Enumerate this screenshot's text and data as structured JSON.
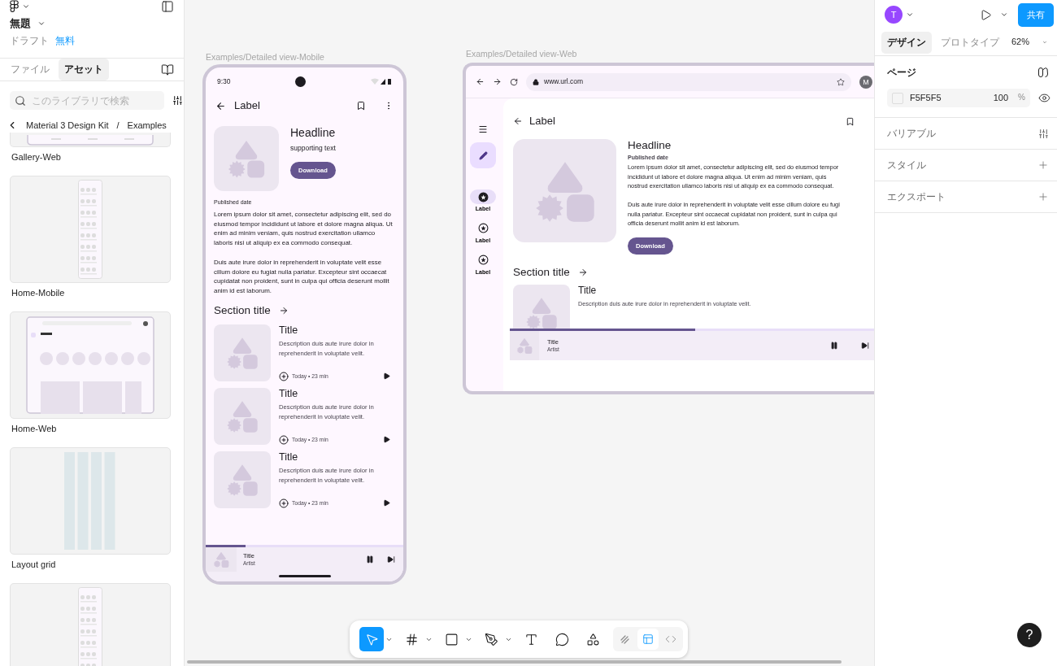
{
  "left_panel": {
    "file_name": "無題",
    "location": "ドラフト",
    "plan": "無料",
    "tabs": [
      {
        "label": "ファイル",
        "selected": false
      },
      {
        "label": "アセット",
        "selected": true
      }
    ],
    "search": {
      "placeholder": "このライブラリで検索"
    },
    "breadcrumb": {
      "library": "Material 3 Design Kit",
      "separator": "/",
      "folder": "Examples"
    },
    "assets": [
      {
        "name": "Gallery-Web",
        "kind": "web_strip"
      },
      {
        "name": "Home-Mobile",
        "kind": "mobile"
      },
      {
        "name": "Home-Web",
        "kind": "web"
      },
      {
        "name": "Layout grid",
        "kind": "grid"
      },
      {
        "kind": "mobile"
      }
    ]
  },
  "canvas": {
    "mobile_frame": {
      "label": "Examples/Detailed view-Mobile",
      "time": "9:30",
      "top_bar_title": "Label",
      "headline": "Headline",
      "supporting_text": "supporting text",
      "button": "Download",
      "date_label": "Published date",
      "paragraphs": [
        "Lorem ipsum dolor sit amet, consectetur adipiscing elit, sed do eiusmod tempor incididunt ut labore et dolore magna aliqua. Ut enim ad minim veniam, quis nostrud exercitation ullamco laboris nisi ut aliquip ex ea commodo consequat.",
        "Duis aute irure dolor in reprehenderit in voluptate velit esse cillum dolore eu fugiat nulla pariatur. Excepteur sint occaecat cupidatat non proident, sunt in culpa qui officia deserunt mollit anim id est laborum."
      ],
      "section_title": "Section title",
      "items": [
        {
          "title": "Title",
          "description": "Description duis aute irure dolor in reprehenderit in voluptate velit.",
          "meta": "Today • 23 min"
        },
        {
          "title": "Title",
          "description": "Description duis aute irure dolor in reprehenderit in voluptate velit.",
          "meta": "Today • 23 min"
        },
        {
          "title": "Title",
          "description": "Description duis aute irure dolor in reprehenderit in voluptate velit.",
          "meta": "Today • 23 min"
        }
      ],
      "player": {
        "title": "Title",
        "artist": "Artist",
        "level": 0.2
      }
    },
    "web_frame": {
      "label": "Examples/Detailed view-Web",
      "url": "www.url.com",
      "avatar": "M",
      "nav": [
        {
          "label": "Label",
          "selected": true
        },
        {
          "label": "Label",
          "selected": false
        },
        {
          "label": "Label",
          "selected": false
        }
      ],
      "top_bar_title": "Label",
      "headline": "Headline",
      "date_label": "Published date",
      "paragraphs": [
        [
          "Lorem ipsum dolor sit amet, consectetur adipiscing elit, sed do eiusmod tempor",
          "incididunt ut labore et dolore magna aliqua. Ut enim ad minim veniam, quis",
          "nostrud exercitation ullamco laboris nisi ut aliquip ex ea commodo consequat."
        ],
        [
          "Duis aute irure dolor in reprehenderit in voluptate velit esse cillum dolore eu fugi",
          "nulla pariatur. Excepteur sint occaecat cupidatat non proident, sunt in culpa qui",
          "officia deserunt mollit anim id est laborum."
        ]
      ],
      "button": "Download",
      "section_title": "Section title",
      "items": [
        {
          "title": "Title",
          "description": "Description duis aute irure dolor in reprehenderit in voluptate velit."
        }
      ],
      "player": {
        "title": "Title",
        "artist": "Artist",
        "level": 0.51
      }
    },
    "toolbar": {
      "tools": [
        {
          "kind": "move",
          "selected": true,
          "menu": true
        },
        {
          "kind": "frame",
          "selected": false,
          "menu": true
        },
        {
          "kind": "rect",
          "selected": false,
          "menu": true
        },
        {
          "kind": "pen",
          "selected": false,
          "menu": true
        },
        {
          "kind": "text",
          "selected": false,
          "menu": false
        },
        {
          "kind": "comment",
          "selected": false,
          "menu": false
        },
        {
          "kind": "components",
          "selected": false,
          "menu": false
        }
      ],
      "modes": [
        {
          "kind": "draw",
          "selected": false
        },
        {
          "kind": "design",
          "selected": true
        },
        {
          "kind": "dev",
          "selected": false
        }
      ]
    },
    "help": "?"
  },
  "right_panel": {
    "avatar": "T",
    "share": "共有",
    "tabs": [
      {
        "label": "デザイン",
        "selected": true
      },
      {
        "label": "プロトタイプ",
        "selected": false
      }
    ],
    "zoom": "62%",
    "page_section": "ページ",
    "page_color": {
      "hex": "F5F5F5",
      "opacity": "100",
      "unit": "%"
    },
    "sections": [
      {
        "label": "バリアブル",
        "kind": "library"
      },
      {
        "label": "スタイル",
        "kind": "add"
      },
      {
        "label": "エクスポート",
        "kind": "add"
      }
    ]
  }
}
